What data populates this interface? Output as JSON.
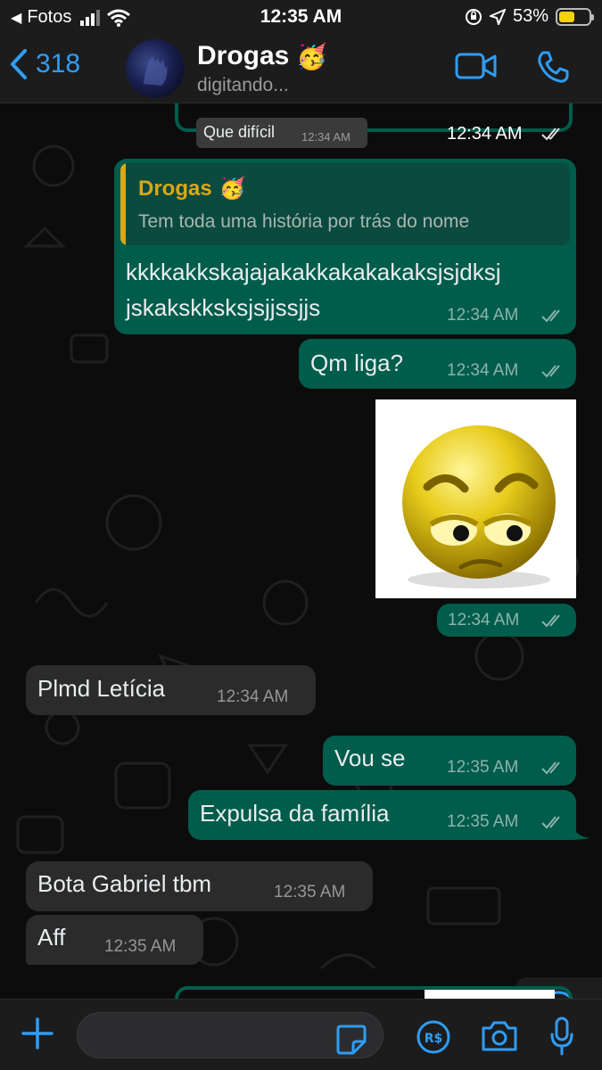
{
  "status_bar": {
    "back_app": "Fotos",
    "time": "12:35 AM",
    "battery_percent": "53%",
    "battery_level": 0.53
  },
  "header": {
    "back_count": "318",
    "title": "Drogas",
    "title_emoji": "🥳",
    "subtitle": "digitando..."
  },
  "messages": [
    {
      "dir": "out",
      "quoted_text": "Que difícil",
      "quoted_time": "12:34 AM",
      "time": "12:34 AM",
      "status": "read"
    },
    {
      "dir": "out",
      "reply_to_name": "Drogas",
      "reply_to_emoji": "🥳",
      "reply_to_text": "Tem toda uma história por trás do nome",
      "text_line1": "kkkkakkskajajakakkakakakaksjsjdksj",
      "text_line2": "jskakskksksjsjjssjjs",
      "time": "12:34 AM",
      "status": "read"
    },
    {
      "dir": "out",
      "text": "Qm liga?",
      "time": "12:34 AM",
      "status": "read"
    },
    {
      "dir": "out",
      "type": "sticker",
      "sticker": "annoyed-smiley",
      "time": "12:34 AM",
      "status": "read"
    },
    {
      "dir": "in",
      "text": "Plmd Letícia",
      "time": "12:34 AM"
    },
    {
      "dir": "out",
      "text": "Vou se",
      "time": "12:35 AM",
      "status": "read"
    },
    {
      "dir": "out",
      "text": "Expulsa da família",
      "time": "12:35 AM",
      "status": "read"
    },
    {
      "dir": "in",
      "text": "Bota Gabriel tbm",
      "time": "12:35 AM"
    },
    {
      "dir": "in",
      "text": "Aff",
      "time": "12:35 AM"
    }
  ],
  "icons": {
    "accent": "#2f9df4",
    "outgoing_bubble": "#005c4b",
    "incoming_bubble": "#2b2b2b"
  },
  "input": {
    "placeholder": ""
  }
}
